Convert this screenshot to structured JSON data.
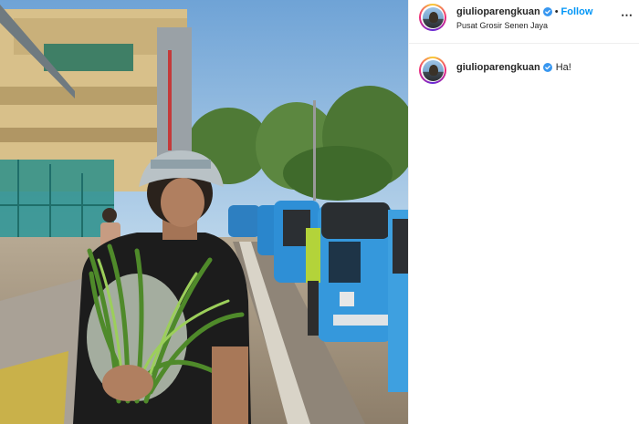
{
  "post": {
    "photo_alt": "",
    "author": {
      "username": "giulioparengkuan",
      "verified": true,
      "follow_label": "Follow",
      "separator": "•",
      "location": "Pusat Grosir Senen Jaya",
      "more_icon": "ellipsis-icon"
    },
    "caption": {
      "username": "giulioparengkuan",
      "verified": true,
      "text": "Ha!"
    },
    "colors": {
      "verified_badge": "#3897f0",
      "follow": "#0095f6",
      "text": "#262626",
      "divider": "#efefef"
    }
  }
}
